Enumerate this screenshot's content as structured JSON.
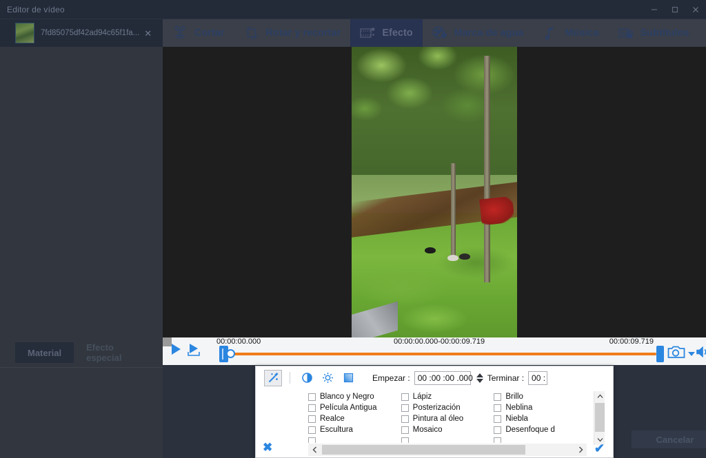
{
  "window": {
    "title": "Editor de vídeo",
    "controls": {
      "minimize": "minimize-icon",
      "maximize": "maximize-icon",
      "close": "close-icon"
    }
  },
  "file_tab": {
    "name": "7fd85075df42ad94c65f1fa...",
    "close": "✕",
    "thumbnail": "video-thumbnail"
  },
  "toolbar": {
    "items": [
      {
        "label": "Cortar",
        "icon": "scissors-icon",
        "active": false
      },
      {
        "label": "Rotar y recortar",
        "icon": "crop-rotate-icon",
        "active": false
      },
      {
        "label": "Efecto",
        "icon": "film-effect-icon",
        "active": true
      },
      {
        "label": "Marca de agua",
        "icon": "watermark-icon",
        "active": false
      },
      {
        "label": "Música",
        "icon": "music-note-icon",
        "active": false
      },
      {
        "label": "Subtítulos",
        "icon": "subtitles-icon",
        "active": false
      }
    ]
  },
  "left_panel": {
    "tabs": [
      {
        "label": "Material",
        "active": true
      },
      {
        "label": "Efecto especial",
        "active": false
      }
    ]
  },
  "player": {
    "play_icon": "play-icon",
    "play_segment_icon": "play-segment-icon",
    "stop_icon": "stop-icon",
    "time_start": "00:00:00.000",
    "time_range": "00:00:00.000-00:00:09.719",
    "time_end": "00:00:09.719",
    "snapshot_icon": "camera-icon",
    "snapshot_caret_icon": "chevron-down-icon",
    "volume_icon": "speaker-icon",
    "track_color": "#f07c18",
    "handle_color": "#2b86e0"
  },
  "bottom_buttons": {
    "ok_label": "",
    "cancel_label": "Cancelar"
  },
  "effects_dialog": {
    "tools": [
      {
        "name": "magic-wand-icon",
        "pressed": true
      },
      {
        "name": "contrast-icon",
        "pressed": false
      },
      {
        "name": "brightness-icon",
        "pressed": false
      },
      {
        "name": "saturation-icon",
        "pressed": false
      }
    ],
    "start_label": "Empezar :",
    "start_value": "00 :00 :00 .000",
    "end_label": "Terminar :",
    "end_value": "00 :",
    "columns": [
      [
        "Blanco y Negro",
        "Película Antigua",
        "Realce",
        "Escultura",
        ""
      ],
      [
        "Lápiz",
        "Posterización",
        "Pintura al óleo",
        "Mosaico",
        ""
      ],
      [
        "Brillo",
        "Neblina",
        "Niebla",
        "Desenfoque d",
        ""
      ]
    ],
    "scroll_up_icon": "chevron-up-icon",
    "scroll_down_icon": "chevron-down-icon",
    "scroll_left_icon": "chevron-left-icon",
    "scroll_right_icon": "chevron-right-icon",
    "cancel_icon": "✖",
    "confirm_icon": "✔",
    "accent_color": "#2b86e0"
  }
}
